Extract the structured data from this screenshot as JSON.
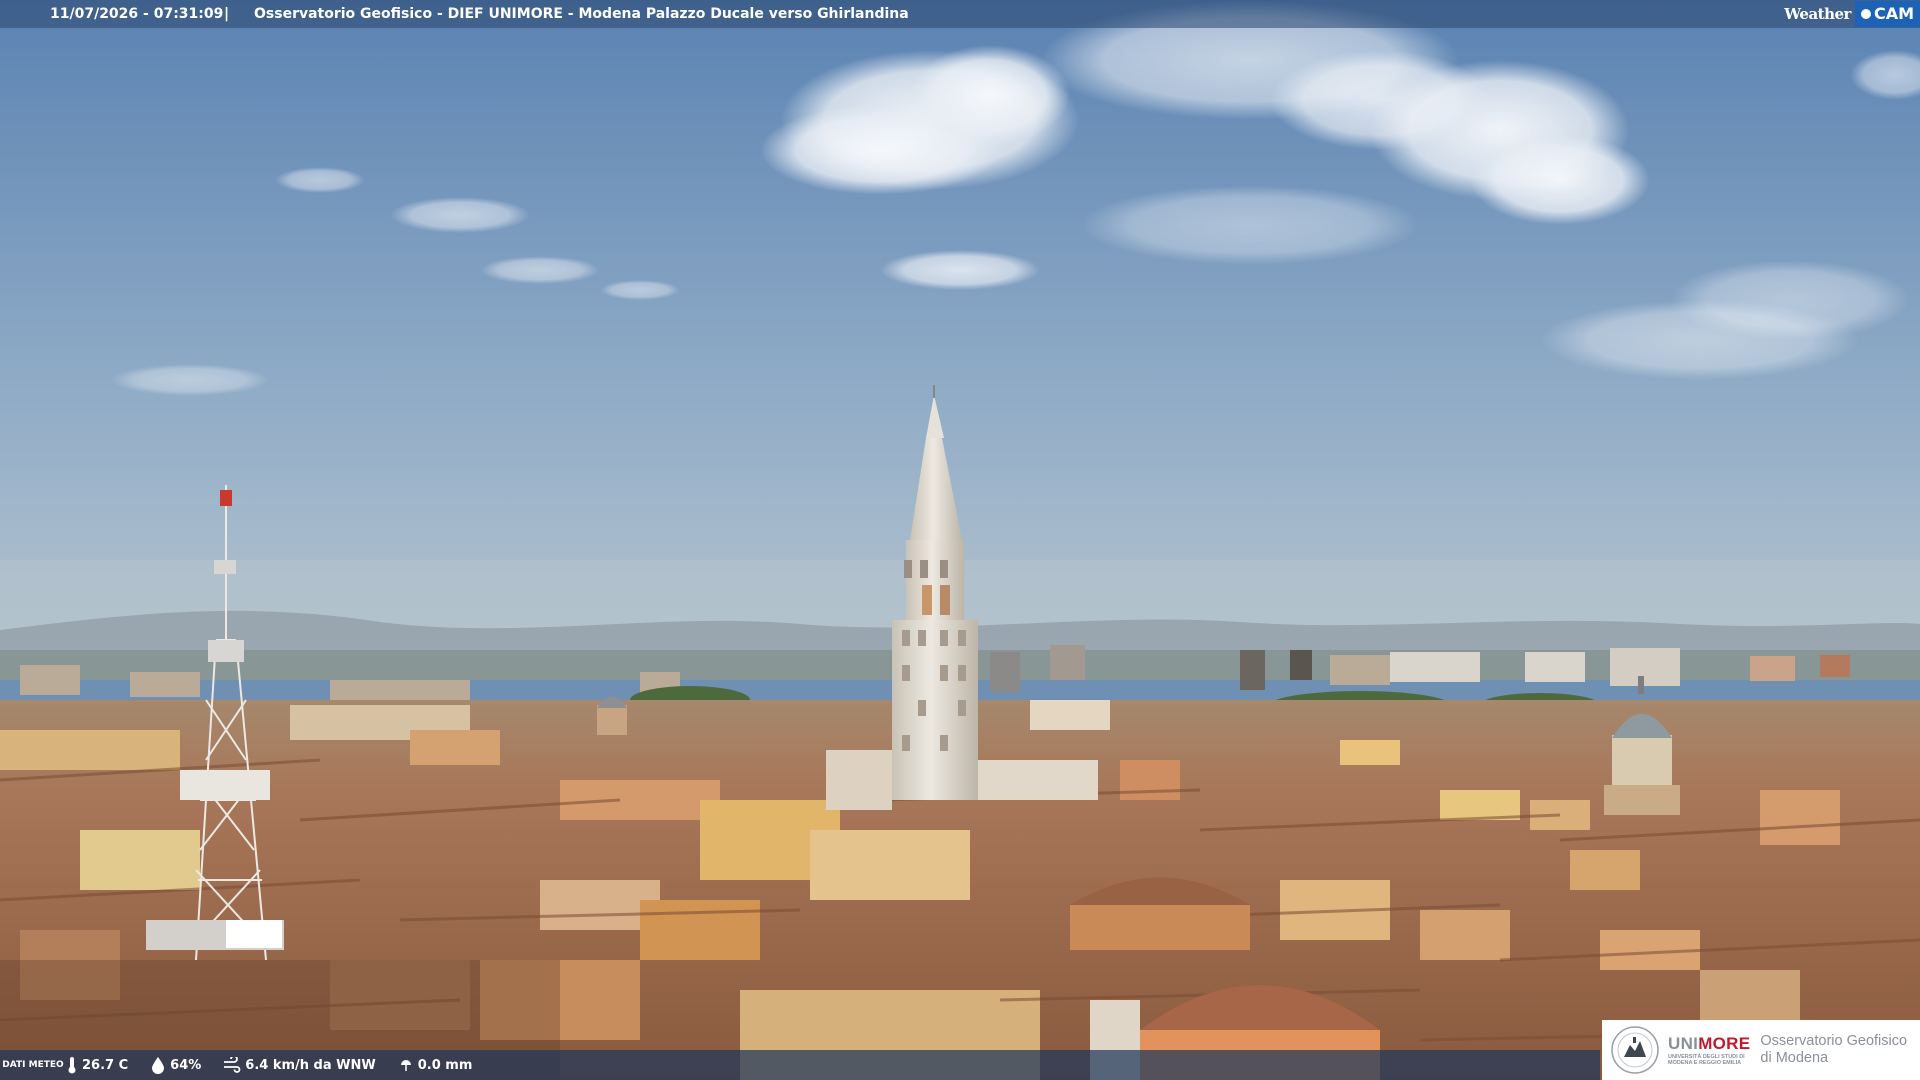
{
  "overlay": {
    "timestamp": "11/07/2026 - 07:31:09",
    "separator": "|",
    "title": "Osservatorio Geofisico - DIEF UNIMORE - Modena Palazzo Ducale verso Ghirlandina",
    "brand_word": "Weather",
    "brand_cam": "CAM"
  },
  "weather": {
    "label": "DATI METEO",
    "temperature": "26.7 C",
    "humidity": "64%",
    "wind": "6.4 km/h da WNW",
    "rain": "0.0 mm",
    "icons": [
      "thermometer-icon",
      "humidity-drop-icon",
      "wind-icon",
      "rain-icon"
    ]
  },
  "logo": {
    "uni_gray": "UNI",
    "uni_red": "MORE",
    "uni_line1": "UNIVERSITÀ DEGLI STUDI DI",
    "uni_line2": "MODENA E REGGIO EMILIA",
    "obs_line1": "Osservatorio Geofisico",
    "obs_line2": "di Modena"
  },
  "colors": {
    "sky_top": "#5a82b2",
    "sky_horizon": "#b6c6d2",
    "roof": "#a86b4a",
    "facade": "#d8a86a",
    "tower": "#e2ddd2",
    "unimore_red": "#c4182d"
  }
}
